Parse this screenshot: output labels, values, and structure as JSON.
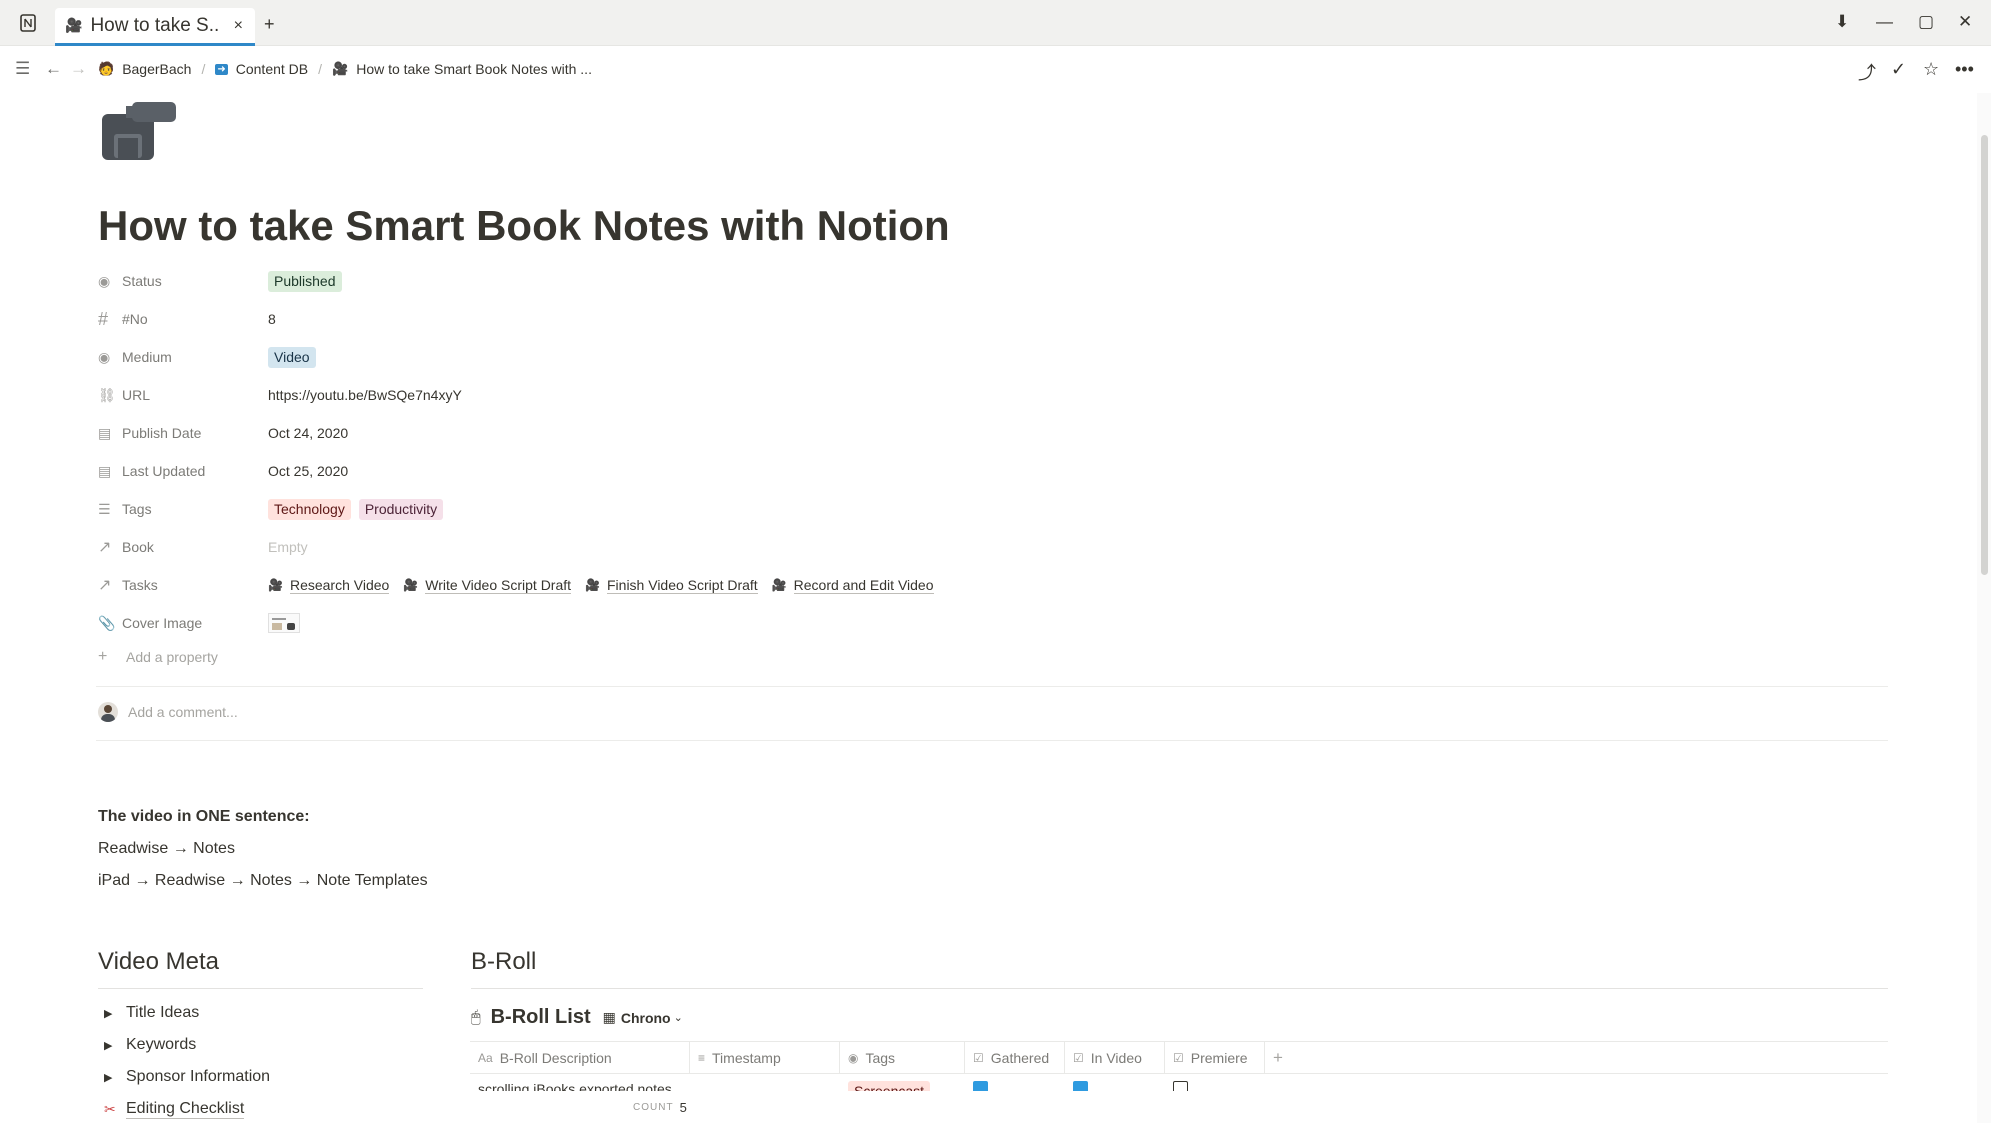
{
  "window": {
    "tab_title": "How to take S...",
    "new_tab": "+",
    "close_tab": "×"
  },
  "breadcrumb": [
    {
      "label": "BagerBach",
      "icon": "person-icon"
    },
    {
      "label": "Content DB",
      "icon": "arrow-box-icon"
    },
    {
      "label": "How to take Smart Book Notes with ...",
      "icon": "video-camera-icon"
    }
  ],
  "page": {
    "icon": "video-camera-icon",
    "title": "How to take Smart Book Notes with Notion"
  },
  "properties": {
    "status": {
      "name": "Status",
      "value": "Published"
    },
    "no": {
      "name": "#No",
      "value": "8"
    },
    "medium": {
      "name": "Medium",
      "value": "Video"
    },
    "url": {
      "name": "URL",
      "value": "https://youtu.be/BwSQe7n4xyY"
    },
    "publish_date": {
      "name": "Publish Date",
      "value": "Oct 24, 2020"
    },
    "last_updated": {
      "name": "Last Updated",
      "value": "Oct 25, 2020"
    },
    "tags": {
      "name": "Tags",
      "values": [
        "Technology",
        "Productivity"
      ]
    },
    "book": {
      "name": "Book",
      "value": "Empty"
    },
    "tasks": {
      "name": "Tasks",
      "values": [
        "Research Video",
        "Write Video Script Draft",
        "Finish Video Script Draft",
        "Record and Edit Video"
      ]
    },
    "cover_image": {
      "name": "Cover Image"
    },
    "add_property": "Add a property"
  },
  "comment": {
    "placeholder": "Add a comment..."
  },
  "summary": {
    "heading": "The video in ONE sentence:",
    "line1": "Readwise → Notes",
    "line2": "iPad → Readwise → Notes → Note Templates"
  },
  "video_meta": {
    "heading": "Video Meta",
    "items": [
      "Title Ideas",
      "Keywords",
      "Sponsor Information",
      "Editing Checklist"
    ]
  },
  "broll": {
    "heading": "B-Roll",
    "db_title": "B-Roll List",
    "view_name": "Chrono",
    "columns": [
      "B-Roll Description",
      "Timestamp",
      "Tags",
      "Gathered",
      "In Video",
      "Premiere"
    ],
    "row": {
      "description": "scrolling iBooks exported notes",
      "tag": "Screencast",
      "gathered": true,
      "in_video": true,
      "premiere": false
    },
    "count_label": "COUNT",
    "count_value": "5"
  },
  "colors": {
    "accent": "#2f88c8",
    "checkbox": "#2f9be0",
    "tag_green": "#dbeddb",
    "tag_blue": "#d3e5ef",
    "tag_red": "#ffe2dd",
    "tag_pink": "#f5e0e9"
  }
}
